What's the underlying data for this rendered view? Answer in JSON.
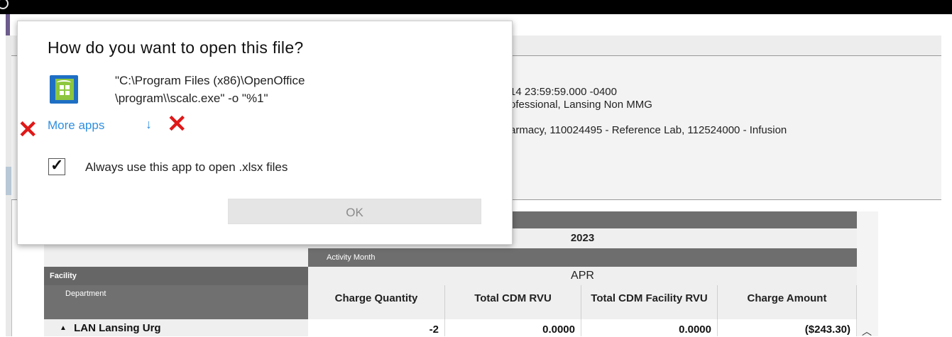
{
  "dialog": {
    "title": "How do you want to open this file?",
    "app_command_line1": "\"C:\\Program Files (x86)\\OpenOffice",
    "app_command_line2": "\\program\\\\scalc.exe\" -o \"%1\"",
    "more_apps_label": "More apps",
    "more_apps_arrow": "↓",
    "always_use_label": "Always use this app to open .xlsx files",
    "always_use_checked": true,
    "ok_label": "OK",
    "app_icon": "openoffice-calc-icon",
    "annotation_marks": [
      "red-x",
      "red-x"
    ]
  },
  "background": {
    "info_lines": [
      "14 23:59:59.000 -0400",
      "ofessional, Lansing Non MMG",
      "armacy, 110024495 - Reference Lab, 112524000 - Infusion"
    ]
  },
  "report": {
    "year": "2023",
    "activity_month_label": "Activity Month",
    "month": "APR",
    "facility_label": "Facility",
    "department_label": "Department",
    "columns": [
      "Charge Quantity",
      "Total CDM RVU",
      "Total CDM Facility RVU",
      "Charge Amount"
    ],
    "rows": [
      {
        "expander": "▲",
        "facility": "LAN Lansing Urg",
        "values": [
          "-2",
          "0.0000",
          "0.0000",
          "($243.30)"
        ]
      }
    ]
  },
  "colors": {
    "link_blue": "#2e8fe0",
    "annotation_red": "#e01818",
    "table_header_dark": "#666666"
  }
}
